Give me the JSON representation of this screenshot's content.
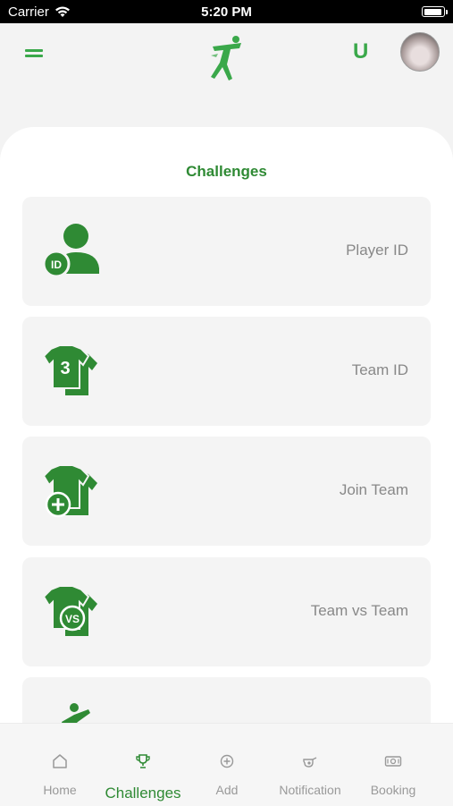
{
  "status_bar": {
    "carrier": "Carrier",
    "time": "5:20 PM"
  },
  "header": {
    "user_initial": "U"
  },
  "page": {
    "title": "Challenges"
  },
  "cards": [
    {
      "label": "Player ID",
      "icon": "player-id-icon"
    },
    {
      "label": "Team ID",
      "icon": "team-id-icon"
    },
    {
      "label": "Join Team",
      "icon": "join-team-icon"
    },
    {
      "label": "Team vs Team",
      "icon": "team-vs-team-icon"
    },
    {
      "label": "",
      "icon": "player-kick-icon"
    }
  ],
  "nav": [
    {
      "label": "Home",
      "icon": "home-icon",
      "active": false
    },
    {
      "label": "Challenges",
      "icon": "trophy-icon",
      "active": true
    },
    {
      "label": "Add",
      "icon": "add-icon",
      "active": false
    },
    {
      "label": "Notification",
      "icon": "whistle-icon",
      "active": false
    },
    {
      "label": "Booking",
      "icon": "ticket-icon",
      "active": false
    }
  ],
  "colors": {
    "accent": "#2f8a34",
    "accent_light": "#3aa84a",
    "muted": "#999999"
  }
}
